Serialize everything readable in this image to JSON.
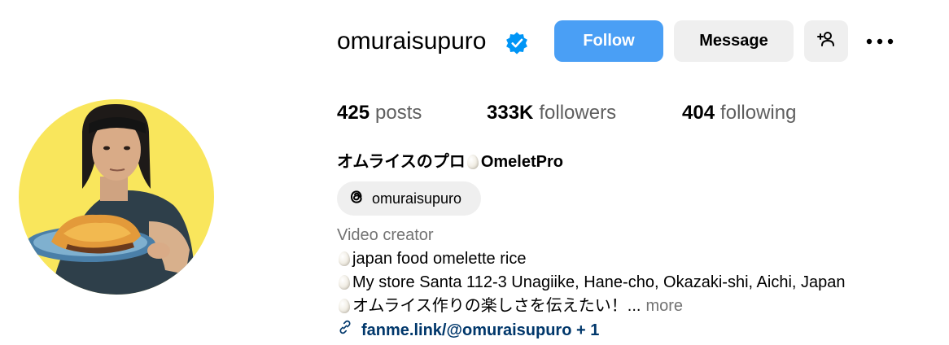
{
  "profile": {
    "username": "omuraisupuro",
    "verified": true,
    "display_name": "オムライスのプロ",
    "display_name_suffix": "OmeletPro",
    "threads_handle": "omuraisupuro",
    "category": "Video creator",
    "bio_lines": [
      "japan food omelette rice",
      "My store Santa 112-3 Unagiike, Hane-cho, Okazaki-shi, Aichi, Japan",
      "オムライス作りの楽しさを伝えたい！..."
    ],
    "more_label": "more",
    "link_text": "fanme.link/@omuraisupuro + 1"
  },
  "buttons": {
    "follow": "Follow",
    "message": "Message"
  },
  "stats": {
    "posts_count": "425",
    "posts_label": "posts",
    "followers_count": "333K",
    "followers_label": "followers",
    "following_count": "404",
    "following_label": "following"
  },
  "icons": {
    "verified": "verified-badge-icon",
    "add_user": "add-user-icon",
    "more": "more-options-icon",
    "threads": "threads-icon",
    "link": "link-icon",
    "egg": "egg-emoji-icon"
  },
  "colors": {
    "follow_button": "#4a9ff5",
    "secondary_button": "#efefef",
    "verified_badge": "#0095f6",
    "link_text": "#00376b",
    "muted_text": "#737373",
    "avatar_background": "#f9e65c"
  }
}
